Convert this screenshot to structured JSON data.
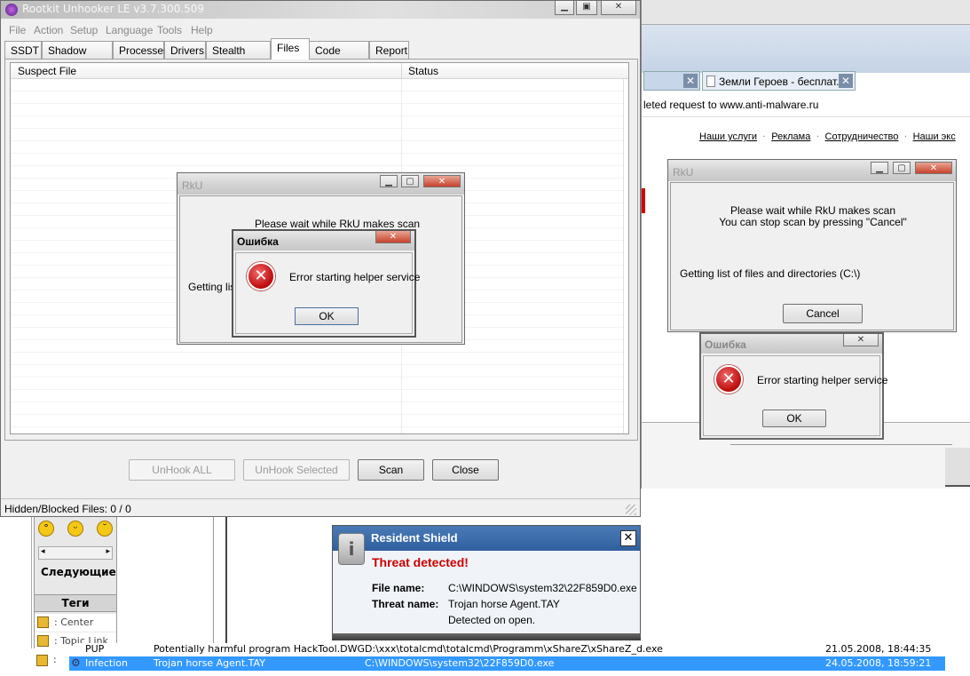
{
  "main_window": {
    "title": "Rootkit Unhooker LE v3.7.300.509",
    "menu": [
      "File",
      "Action",
      "Setup",
      "Language",
      "Tools",
      "Help"
    ],
    "tabs": [
      "SSDT",
      "Shadow SSDT",
      "Processes",
      "Drivers",
      "Stealth Code",
      "Files",
      "Code Hooks",
      "Report"
    ],
    "active_tab": "Files",
    "columns": [
      "Suspect File",
      "Status"
    ],
    "buttons": {
      "unhook_all": "UnHook ALL",
      "unhook_selected": "UnHook Selected",
      "scan": "Scan",
      "close": "Close"
    },
    "status": "Hidden/Blocked Files: 0 / 0"
  },
  "rku_dialog_left": {
    "title": "RkU",
    "message": "Please wait while RkU makes scan",
    "progress": "Getting list"
  },
  "error_dialog_left": {
    "title": "Ошибка",
    "message": "Error starting helper service",
    "ok": "OK"
  },
  "browser": {
    "tab2": "Земли Героев - бесплат...",
    "notice": "leted request to www.anti-malware.ru",
    "links": [
      "Наши услуги",
      "Реклама",
      "Сотрудничество",
      "Наши экс"
    ]
  },
  "rku_dialog_right": {
    "title": "RkU",
    "line1": "Please wait while RkU makes scan",
    "line2": "You can stop scan by pressing \"Cancel\"",
    "progress": "Getting list of files and directories (C:\\)",
    "cancel": "Cancel"
  },
  "error_dialog_right": {
    "title": "Ошибка",
    "message": "Error starting helper service",
    "ok": "OK"
  },
  "forum": {
    "next": "Следующие",
    "tags_header": "Теги",
    "tags": [
      ": Center",
      ": Topic Link",
      ":"
    ]
  },
  "resident_shield": {
    "title": "Resident Shield",
    "headline": "Threat detected!",
    "file_label": "File name:",
    "file_value": "C:\\WINDOWS\\system32\\22F859D0.exe",
    "threat_label": "Threat name:",
    "threat_value": "Trojan horse Agent.TAY",
    "detected": "Detected on open."
  },
  "av_rows": [
    {
      "type": "PUP",
      "threat": "Potentially harmful program HackTool.DWG",
      "path": "D:\\xxx\\totalcmd\\totalcmd\\Programm\\xShareZ\\xShareZ_d.exe",
      "date": "21.05.2008, 18:44:35"
    },
    {
      "type": "Infection",
      "threat": "Trojan horse Agent.TAY",
      "path": "C:\\WINDOWS\\system32\\22F859D0.exe",
      "date": "24.05.2008, 18:59:21"
    }
  ],
  "colors": {
    "accent": "#3399ff",
    "danger": "#cc0000",
    "shield_header": "#2f5f9e"
  }
}
